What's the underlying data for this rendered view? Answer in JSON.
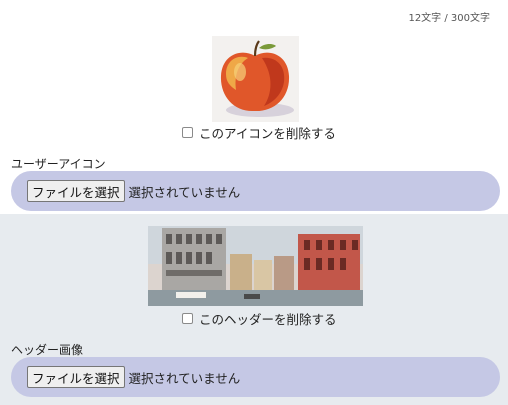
{
  "counter": "12文字 / 300文字",
  "icon": {
    "image_subject": "apple-watercolor",
    "delete_label": "このアイコンを削除する",
    "section_label": "ユーザーアイコン",
    "file_button": "ファイルを選択",
    "file_status": "選択されていません"
  },
  "header": {
    "image_subject": "venice-canal-watercolor",
    "delete_label": "このヘッダーを削除する",
    "section_label": "ヘッダー画像",
    "file_button": "ファイルを選択",
    "file_status": "選択されていません"
  },
  "colors": {
    "pill": "#c5c8e5",
    "lower_background": "#e7ebef"
  }
}
